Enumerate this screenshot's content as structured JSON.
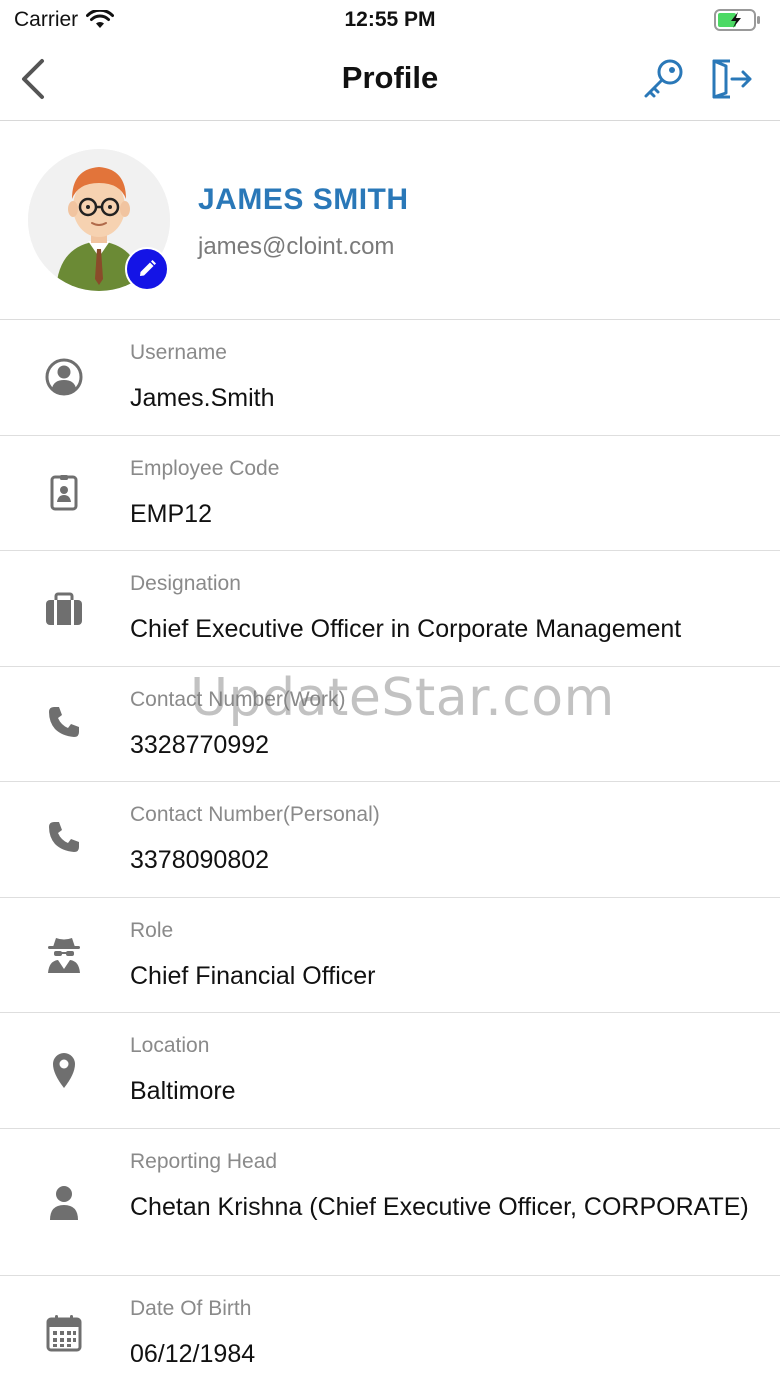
{
  "status_bar": {
    "carrier": "Carrier",
    "time": "12:55 PM"
  },
  "nav": {
    "title": "Profile",
    "back_icon": "chevron-left-icon",
    "key_icon": "key-icon",
    "logout_icon": "logout-icon"
  },
  "profile": {
    "name": "JAMES SMITH",
    "email": "james@cloint.com",
    "edit_icon": "pencil-icon"
  },
  "fields": [
    {
      "label": "Username",
      "value": "James.Smith",
      "icon": "account-circle-icon"
    },
    {
      "label": "Employee Code",
      "value": "EMP12",
      "icon": "id-badge-icon"
    },
    {
      "label": "Designation",
      "value": "Chief Executive Officer in Corporate Management",
      "icon": "briefcase-icon"
    },
    {
      "label": "Contact Number(Work)",
      "value": "3328770992",
      "icon": "phone-icon"
    },
    {
      "label": "Contact Number(Personal)",
      "value": "3378090802",
      "icon": "phone-icon"
    },
    {
      "label": "Role",
      "value": "Chief Financial Officer",
      "icon": "user-secret-icon"
    },
    {
      "label": "Location",
      "value": "Baltimore",
      "icon": "map-marker-icon"
    },
    {
      "label": "Reporting Head",
      "value": "Chetan Krishna (Chief Executive Officer, CORPORATE)",
      "icon": "person-icon"
    },
    {
      "label": "Date Of Birth",
      "value": "06/12/1984",
      "icon": "calendar-icon"
    }
  ],
  "watermark": "UpdateStar.com",
  "colors": {
    "accent_blue": "#2a78b8",
    "edit_badge": "#1414e6",
    "icon_gray": "#6f6f6f",
    "battery_green": "#4cd964"
  }
}
